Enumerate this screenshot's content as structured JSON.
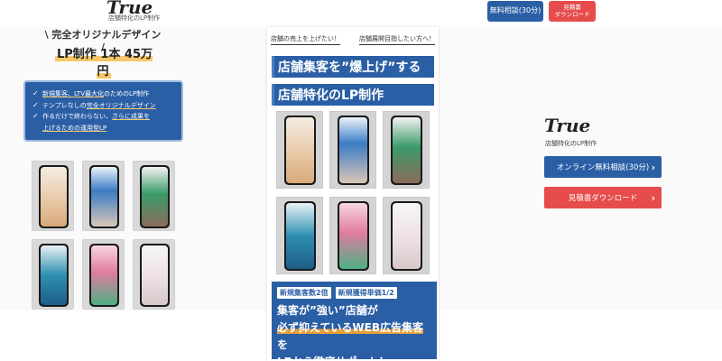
{
  "header": {
    "logo": "True",
    "logo_sub": "店舗特化のLP制作",
    "consult_button": "無料相談(30分)",
    "estimate_button_line1": "見積書",
    "estimate_button_line2": "ダウンロード"
  },
  "left": {
    "lead": "\\ 完全オリジナルデザイン /",
    "price": "LP制作 1本 45万円",
    "features": [
      {
        "pre": "",
        "hl": "新規集客、LTV最大化",
        "post": "のためのLP制作"
      },
      {
        "pre": "テンプレなしの",
        "hl": "完全オリジナルデザイン",
        "post": ""
      },
      {
        "pre": "作るだけで終わらない、",
        "hl": "さらに成果を",
        "post": ""
      },
      {
        "pre": "",
        "hl": "上げるための運用型LP",
        "post": ""
      }
    ]
  },
  "center": {
    "tag_left": "店舗の売上を上げたい！",
    "tag_right": "店舗展開目指したい方へ！",
    "headline1": "店舗集客を”爆上げ”する",
    "headline2": "店舗特化のLP制作",
    "pill1": "新規集客数2倍",
    "pill2": "新規獲得単価1/2",
    "cta_line1": "集客が”強い”店舗が",
    "cta_line2": "必ず抑えているWEB広告集客",
    "cta_line2_suffix": "を",
    "cta_line3": "LPから徹底サポート！"
  },
  "right": {
    "logo": "True",
    "logo_sub": "店舗特化のLP制作",
    "consult_button": "オンライン無料相談(30分)",
    "estimate_button": "見積書ダウンロード"
  },
  "colors": {
    "brand_blue": "#2a5fa5",
    "brand_red": "#e74c4c",
    "highlight": "#f7c86a"
  },
  "icons": {
    "check": "check-icon",
    "arrow": "chevron-right-icon"
  }
}
